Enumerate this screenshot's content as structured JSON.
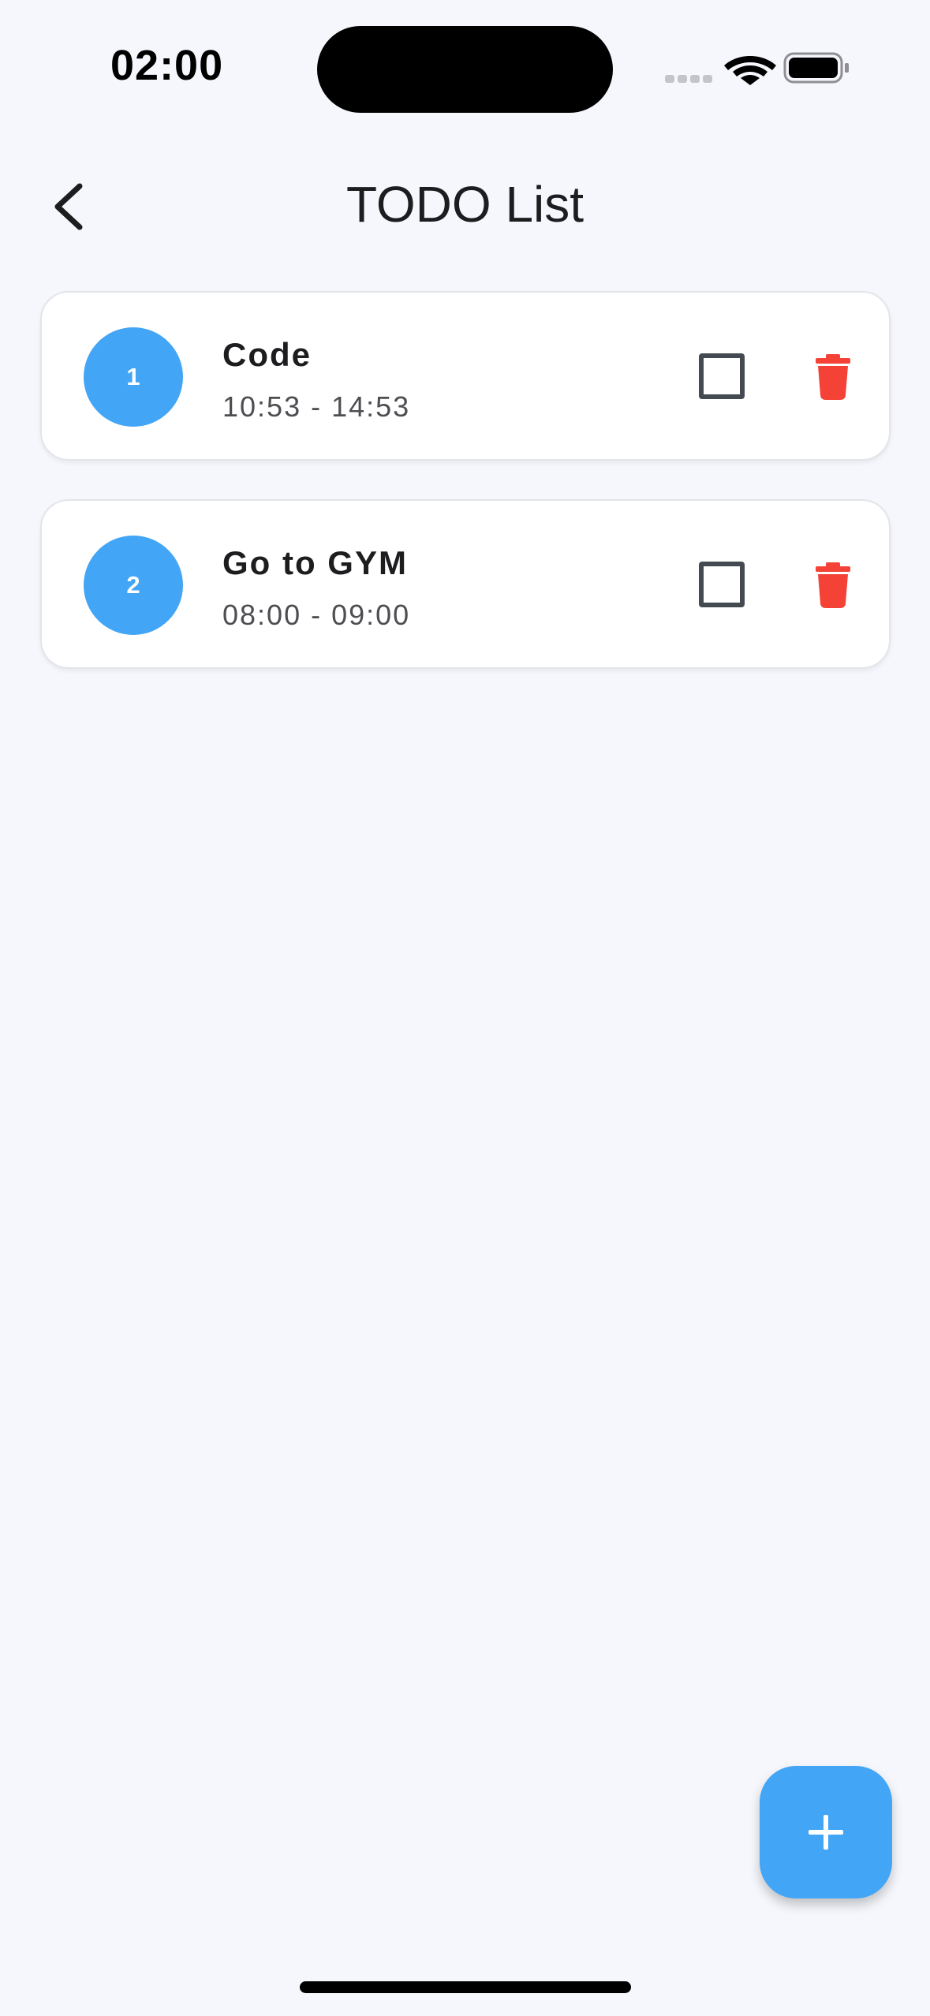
{
  "status_bar": {
    "time": "02:00",
    "icons": [
      "signal-icon",
      "wifi-icon",
      "battery-icon"
    ]
  },
  "header": {
    "back_icon": "chevron-left-icon",
    "title": "TODO List"
  },
  "todos": [
    {
      "index": "1",
      "title": "Code",
      "time": "10:53 - 14:53",
      "checked": false
    },
    {
      "index": "2",
      "title": "Go to GYM",
      "time": "08:00 - 09:00",
      "checked": false
    }
  ],
  "fab": {
    "icon": "plus-icon"
  },
  "colors": {
    "accent": "#42a5f5",
    "delete": "#f44336",
    "background": "#f5f7fc",
    "card": "#ffffff",
    "checkbox_border": "#444a52"
  }
}
